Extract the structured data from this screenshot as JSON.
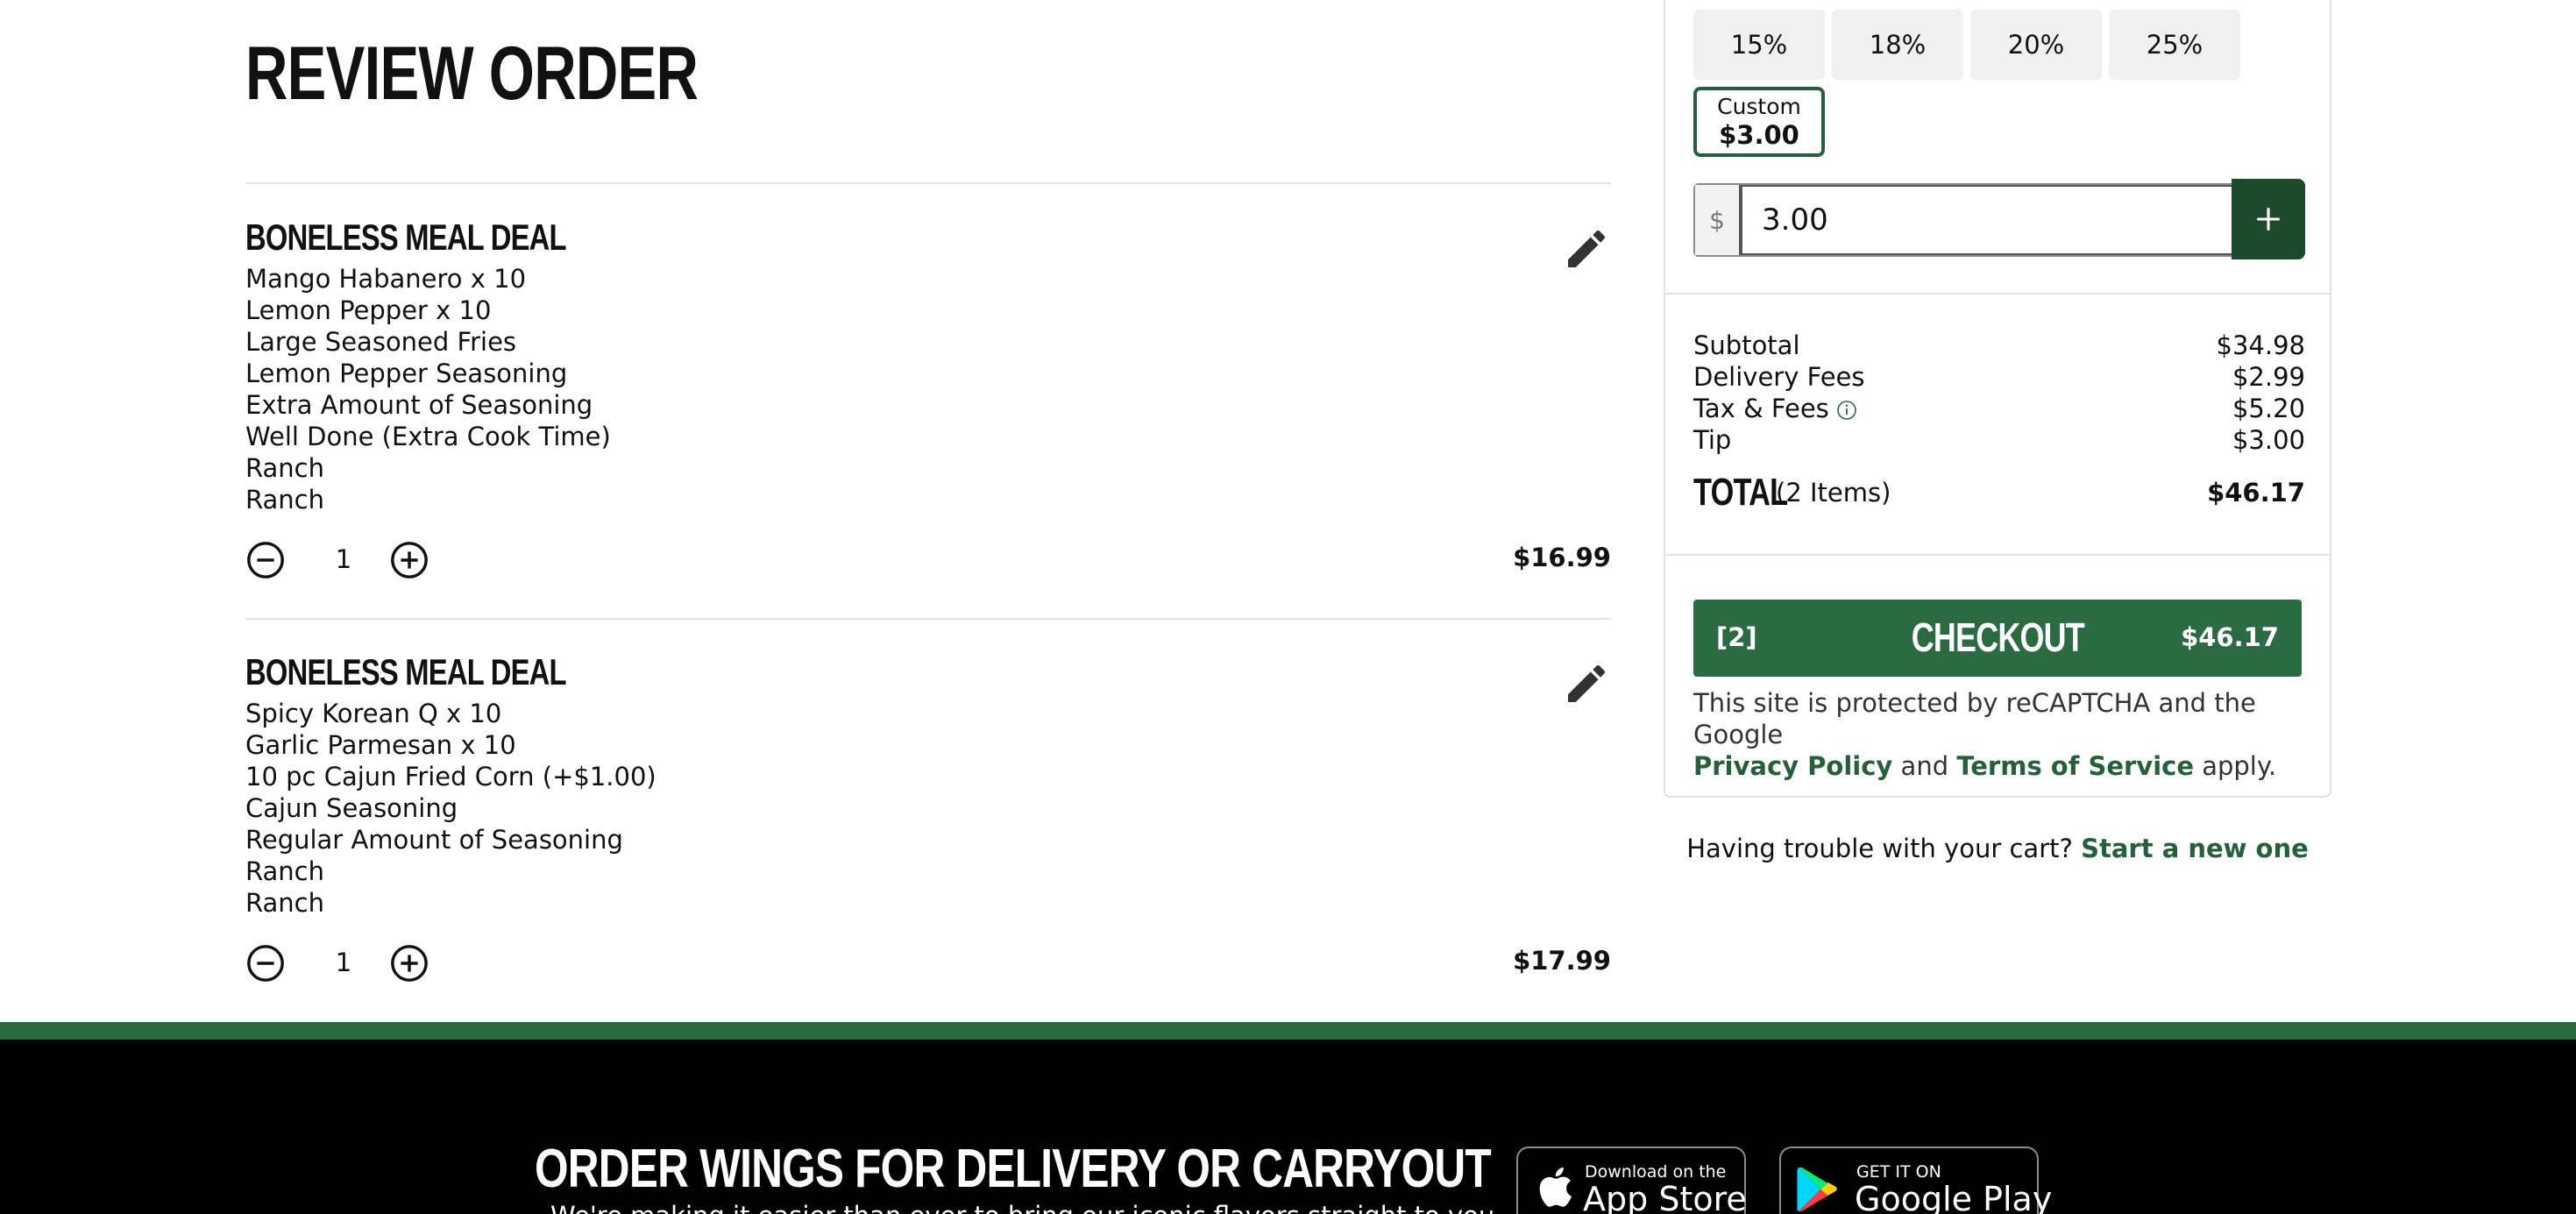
{
  "page": {
    "title": "REVIEW ORDER"
  },
  "items": [
    {
      "name": "BONELESS MEAL DEAL",
      "modifiers": [
        "Mango Habanero x 10",
        "Lemon Pepper x 10",
        "Large Seasoned Fries",
        "Lemon Pepper Seasoning",
        "Extra Amount of Seasoning",
        "Well Done (Extra Cook Time)",
        "Ranch",
        "Ranch"
      ],
      "quantity": "1",
      "price": "$16.99"
    },
    {
      "name": "BONELESS MEAL DEAL",
      "modifiers": [
        "Spicy Korean Q x 10",
        "Garlic Parmesan x 10",
        "10 pc Cajun Fried Corn (+$1.00)",
        "Cajun Seasoning",
        "Regular Amount of Seasoning",
        "Ranch",
        "Ranch"
      ],
      "quantity": "1",
      "price": "$17.99"
    }
  ],
  "tip": {
    "options": [
      "15%",
      "18%",
      "20%",
      "25%"
    ],
    "custom_label": "Custom",
    "custom_value": "$3.00",
    "currency_symbol": "$",
    "input_value": "3.00",
    "add_symbol": "+"
  },
  "summary": {
    "subtotal_label": "Subtotal",
    "subtotal": "$34.98",
    "delivery_label": "Delivery Fees",
    "delivery": "$2.99",
    "tax_label": "Tax & Fees",
    "tax": "$5.20",
    "tip_label": "Tip",
    "tip": "$3.00",
    "total_label": "TOTAL",
    "total_items": "(2 Items)",
    "total": "$46.17"
  },
  "checkout": {
    "count": "[2]",
    "label": "CHECKOUT",
    "amount": "$46.17"
  },
  "recaptcha": {
    "text1": "This site is protected by reCAPTCHA and the Google",
    "privacy": "Privacy Policy",
    "and": "and",
    "terms": "Terms of Service",
    "apply": "apply."
  },
  "trouble": {
    "text": "Having trouble with your cart?",
    "link": "Start a new one"
  },
  "footer": {
    "title": "ORDER WINGS FOR DELIVERY OR CARRYOUT",
    "subtitle": "We're making it easier than ever to bring our iconic flavors straight to you",
    "app_store_small": "Download on the",
    "app_store_big": "App Store",
    "google_small": "GET IT ON",
    "google_big": "Google Play"
  },
  "colors": {
    "brand_green": "#2a6b42",
    "dark_green": "#1d4a2c"
  },
  "icons": [
    "pencil-icon",
    "minus-circle-icon",
    "plus-circle-icon",
    "info-icon",
    "plus-icon",
    "apple-icon",
    "google-play-icon"
  ]
}
